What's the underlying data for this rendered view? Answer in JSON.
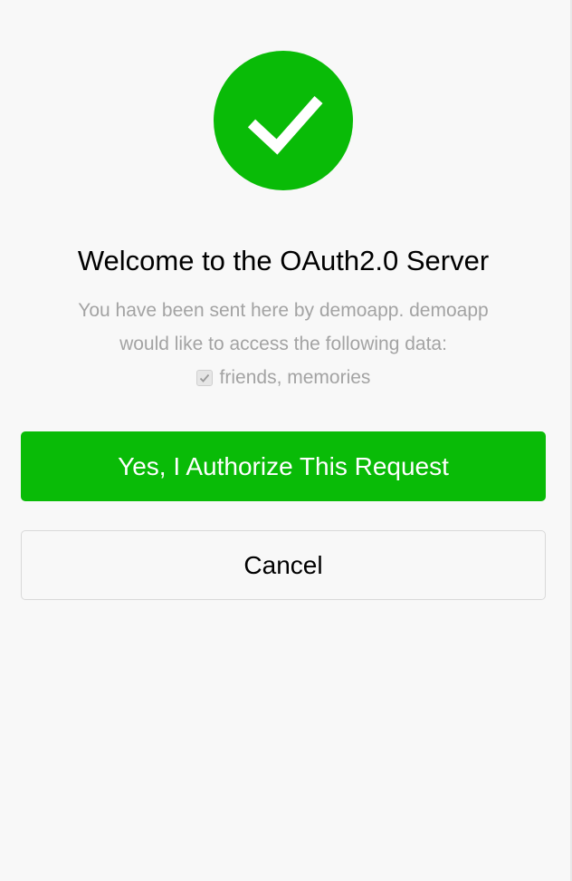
{
  "icon": {
    "name": "checkmark-icon",
    "color": "#09bb07"
  },
  "header": {
    "title": "Welcome to the OAuth2.0 Server"
  },
  "message": {
    "line1": "You have been sent here by demoapp. demoapp",
    "line2": "would like to access the following data:"
  },
  "scopes": {
    "checked": true,
    "label": "friends, memories"
  },
  "actions": {
    "authorize_label": "Yes, I Authorize This Request",
    "cancel_label": "Cancel",
    "primary_color": "#09bb07"
  }
}
